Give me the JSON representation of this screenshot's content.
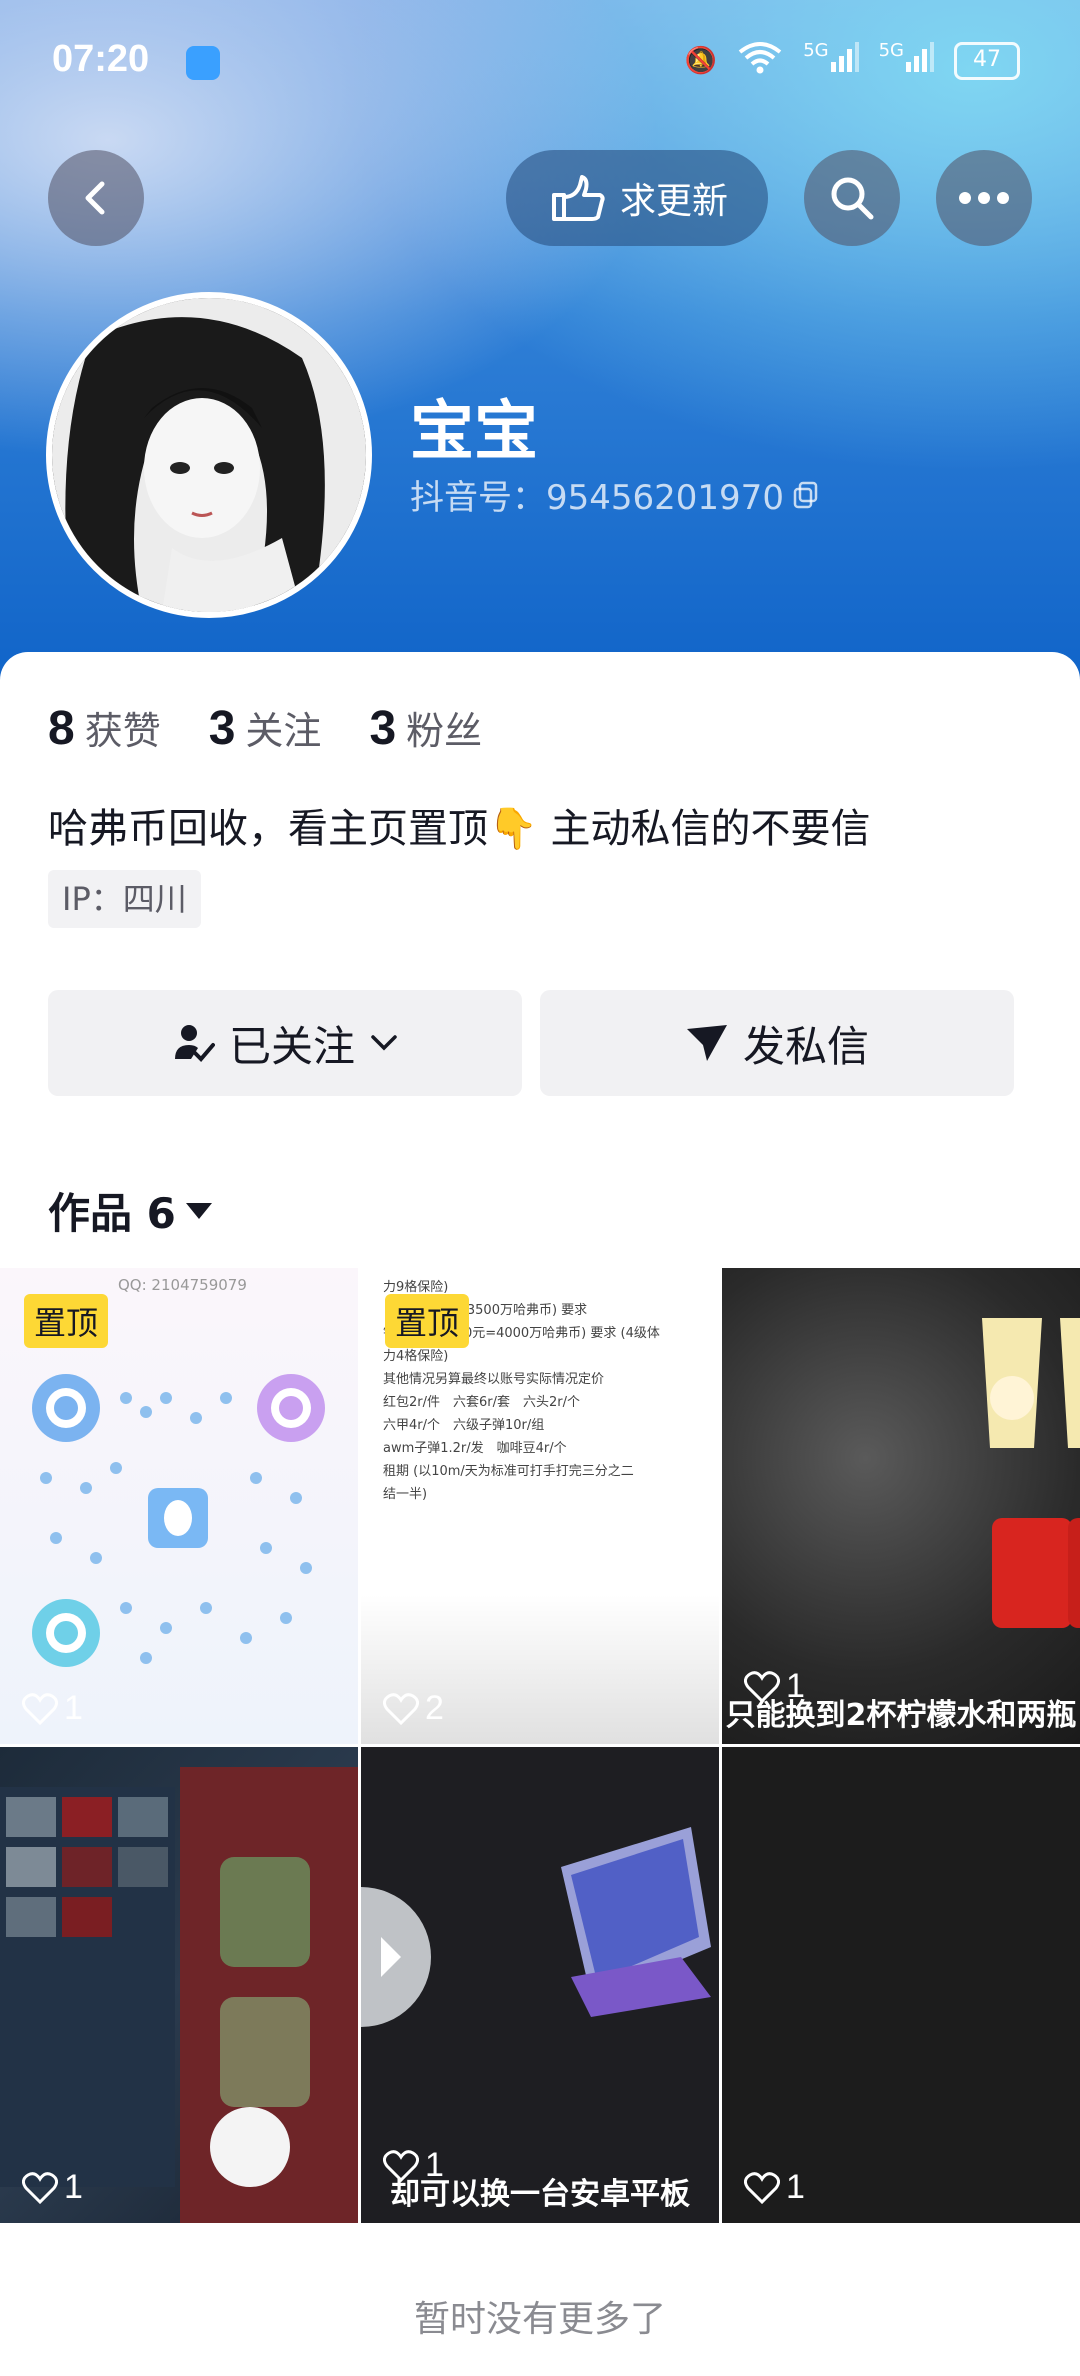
{
  "status_bar": {
    "time": "07:20",
    "battery": "47",
    "network_1": "5G",
    "network_2": "5G"
  },
  "header": {
    "update_label": "求更新"
  },
  "profile": {
    "name": "宝宝",
    "douyin_id": "抖音号：95456201970",
    "stats": [
      {
        "value": "8",
        "label": "获赞"
      },
      {
        "value": "3",
        "label": "关注"
      },
      {
        "value": "3",
        "label": "粉丝"
      }
    ],
    "bio": "哈弗币回收，看主页置顶👇 主动私信的不要信",
    "ip": "IP：四川"
  },
  "actions": {
    "followed_label": "已关注",
    "message_label": "发私信"
  },
  "works": {
    "title": "作品 6",
    "items": [
      {
        "pinned": "置顶",
        "likes": "1",
        "qq": "QQ: 2104759079"
      },
      {
        "pinned": "置顶",
        "likes": "2",
        "lines": [
          "力9格保险)",
          "元=3500万哈弗币) 要求",
          "钱币1:40 (100元=4000万哈弗币) 要求 (4级体",
          "力4格保险)",
          "其他情况另算最终以账号实际情况定价",
          "红包2r/件　六套6r/套　六头2r/个",
          "六甲4r/个　六级子弹10r/组",
          "awm子弹1.2r/发　咖啡豆4r/个",
          "租期 (以10m/天为标准可打手打完三分之二",
          "结一半)"
        ]
      },
      {
        "likes": "1",
        "caption": "只能换到2杯柠檬水和两瓶"
      },
      {
        "likes": "1"
      },
      {
        "likes": "1",
        "caption": "却可以换一台安卓平板"
      },
      {
        "likes": "1"
      }
    ]
  },
  "footer": {
    "text": "暂时没有更多了"
  }
}
